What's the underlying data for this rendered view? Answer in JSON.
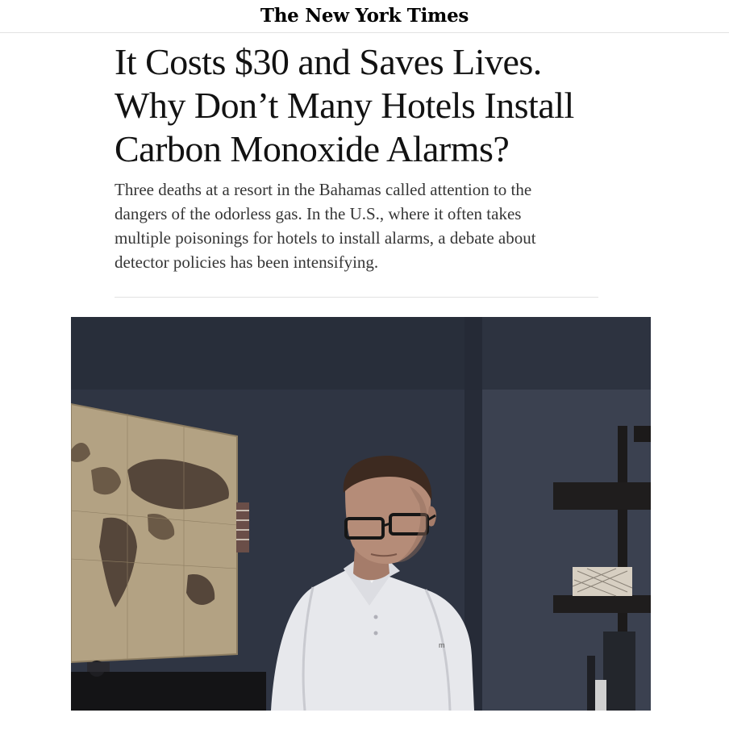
{
  "masthead": {
    "logo": "The New York Times"
  },
  "article": {
    "headline_lines": [
      "It Costs $30 and Saves Lives.",
      "Why Don’t Many Hotels Install",
      "Carbon Monoxide Alarms?"
    ],
    "summary_lines": [
      "Three deaths at a resort in the Bahamas called attention to the",
      "dangers of the odorless gas. In the U.S., where it often takes",
      "multiple poisonings for hotels to install alarms, a debate about",
      "detector policies has been intensifying."
    ]
  },
  "photo": {
    "palette": {
      "wall_left": "#2f3543",
      "wall_right": "#3b4150",
      "map_base": "#b3a283",
      "map_land": "#55463a",
      "shirt": "#e7e8ec",
      "skin": "#b58c78",
      "hair": "#3d2a20",
      "shelf": "#1c1a1a"
    }
  }
}
